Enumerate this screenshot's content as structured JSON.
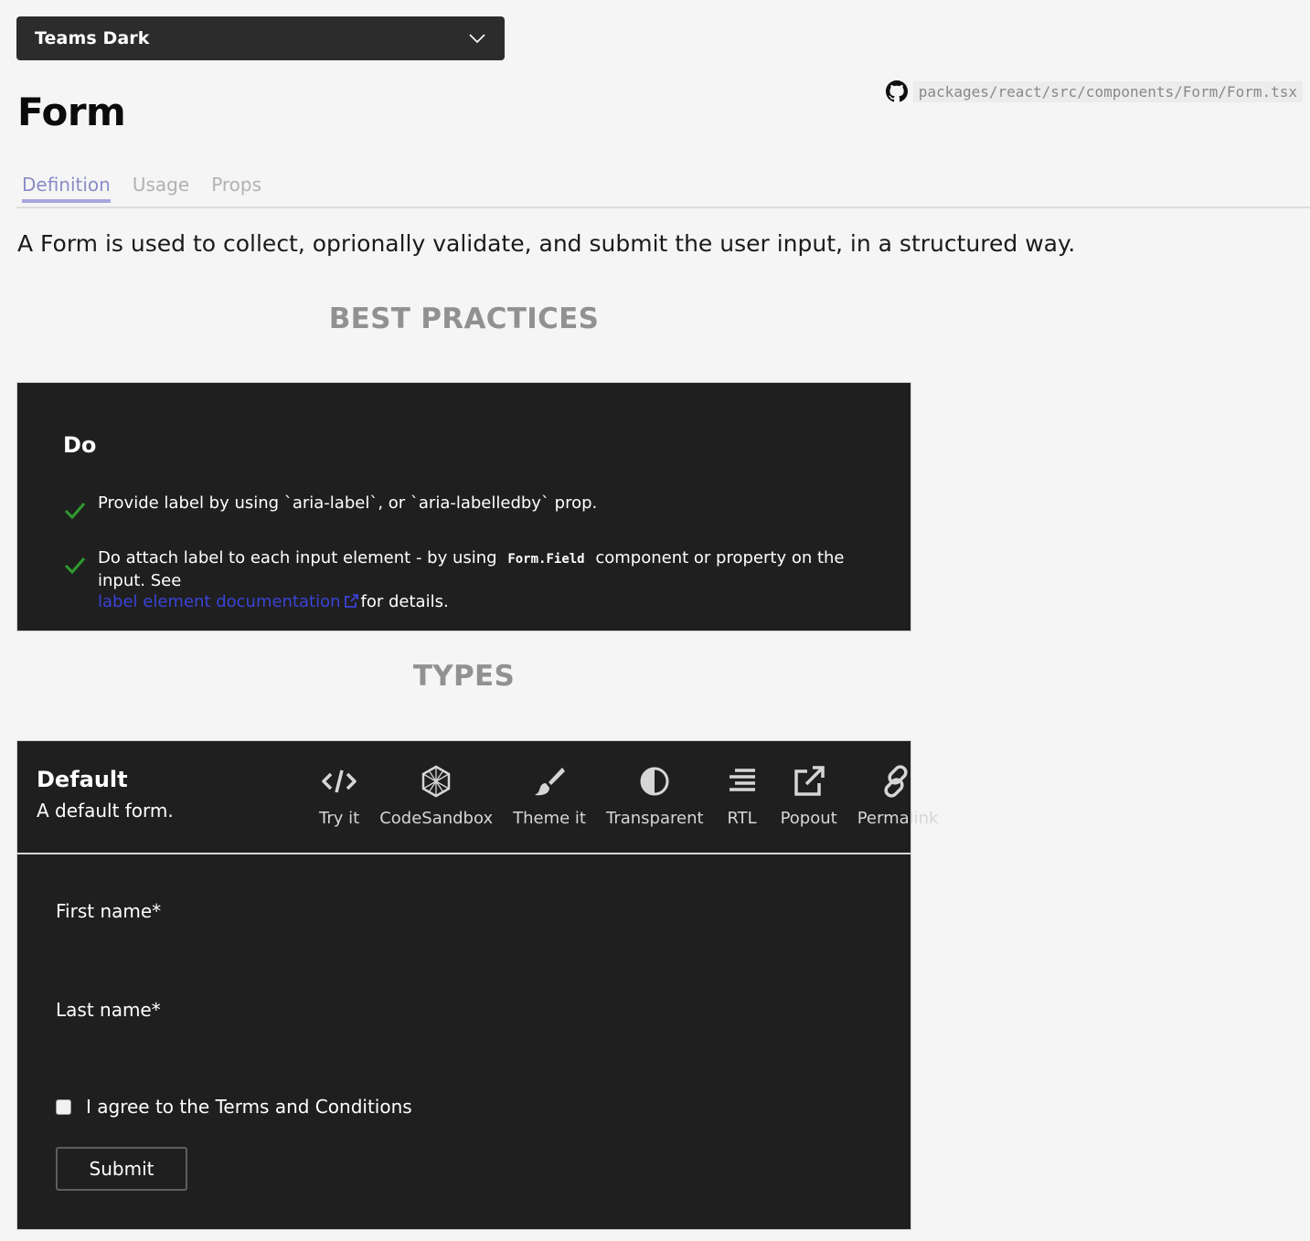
{
  "theme_select": {
    "value": "Teams Dark"
  },
  "source_path": "packages/react/src/components/Form/Form.tsx",
  "page_title": "Form",
  "tabs": [
    {
      "label": "Definition",
      "active": true
    },
    {
      "label": "Usage",
      "active": false
    },
    {
      "label": "Props",
      "active": false
    }
  ],
  "description": "A Form is used to collect, oprionally validate, and submit the user input, in a structured way.",
  "best_practices": {
    "heading": "BEST PRACTICES",
    "do_title": "Do",
    "items": [
      {
        "text": "Provide label by using `aria-label`, or `aria-labelledby` prop."
      },
      {
        "text_before": "Do attach label to each input element - by using",
        "code": "Form.Field",
        "text_after": "component or property on the input. See",
        "link_text": "label element documentation",
        "text_end": "for details."
      }
    ]
  },
  "types": {
    "heading": "TYPES",
    "example": {
      "title": "Default",
      "description": "A default form.",
      "tools": [
        {
          "label": "Try it",
          "icon": "code-icon"
        },
        {
          "label": "CodeSandbox",
          "icon": "codesandbox-icon"
        },
        {
          "label": "Theme it",
          "icon": "paintbrush-icon"
        },
        {
          "label": "Transparent",
          "icon": "half-circle-icon"
        },
        {
          "label": "RTL",
          "icon": "align-right-icon"
        },
        {
          "label": "Popout",
          "icon": "external-link-icon"
        },
        {
          "label": "Permalink",
          "icon": "link-icon"
        }
      ],
      "form": {
        "first_name_label": "First name*",
        "last_name_label": "Last name*",
        "agree_label": "I agree to the Terms and Conditions",
        "submit_label": "Submit"
      }
    }
  },
  "colors": {
    "accent": "#a6a7dc",
    "card_bg": "#1f1f1f",
    "check_green": "#2e9b2e",
    "link": "#3b43d6"
  }
}
